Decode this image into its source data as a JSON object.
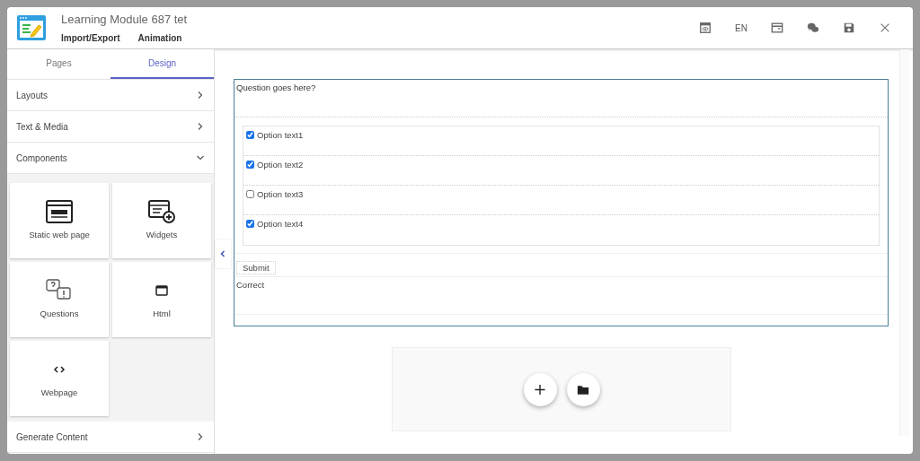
{
  "header": {
    "title": "Learning Module 687 tet",
    "menu": [
      "Import/Export",
      "Animation"
    ],
    "actions": [
      {
        "kind": "preview"
      },
      {
        "kind": "text",
        "label": "EN"
      },
      {
        "kind": "layout"
      },
      {
        "kind": "chat"
      },
      {
        "kind": "save"
      },
      {
        "kind": "close"
      }
    ]
  },
  "sidebar": {
    "tabs": [
      {
        "label": "Pages",
        "selected": false
      },
      {
        "label": "Design",
        "selected": true
      }
    ],
    "sections": [
      {
        "label": "Layouts",
        "expanded": false
      },
      {
        "label": "Text & Media",
        "expanded": false
      },
      {
        "label": "Components",
        "expanded": true,
        "tiles": [
          {
            "kind": "html",
            "label": "Static web page"
          },
          {
            "kind": "widgets",
            "label": "Widgets"
          },
          {
            "kind": "questions",
            "label": "Questions"
          },
          {
            "kind": "window",
            "label": "Html"
          },
          {
            "kind": "code",
            "label": "Webpage"
          }
        ]
      },
      {
        "label": "Generate Content",
        "expanded": false
      }
    ]
  },
  "question": {
    "text": "Question goes here?",
    "options": [
      {
        "label": "Option text1",
        "checked": true
      },
      {
        "label": "Option text2",
        "checked": true
      },
      {
        "label": "Option text3",
        "checked": false
      },
      {
        "label": "Option text4",
        "checked": true
      }
    ],
    "submit": "Submit",
    "feedback": "Correct"
  },
  "add_area": {
    "actions": [
      {
        "kind": "add"
      },
      {
        "kind": "folder"
      }
    ]
  }
}
